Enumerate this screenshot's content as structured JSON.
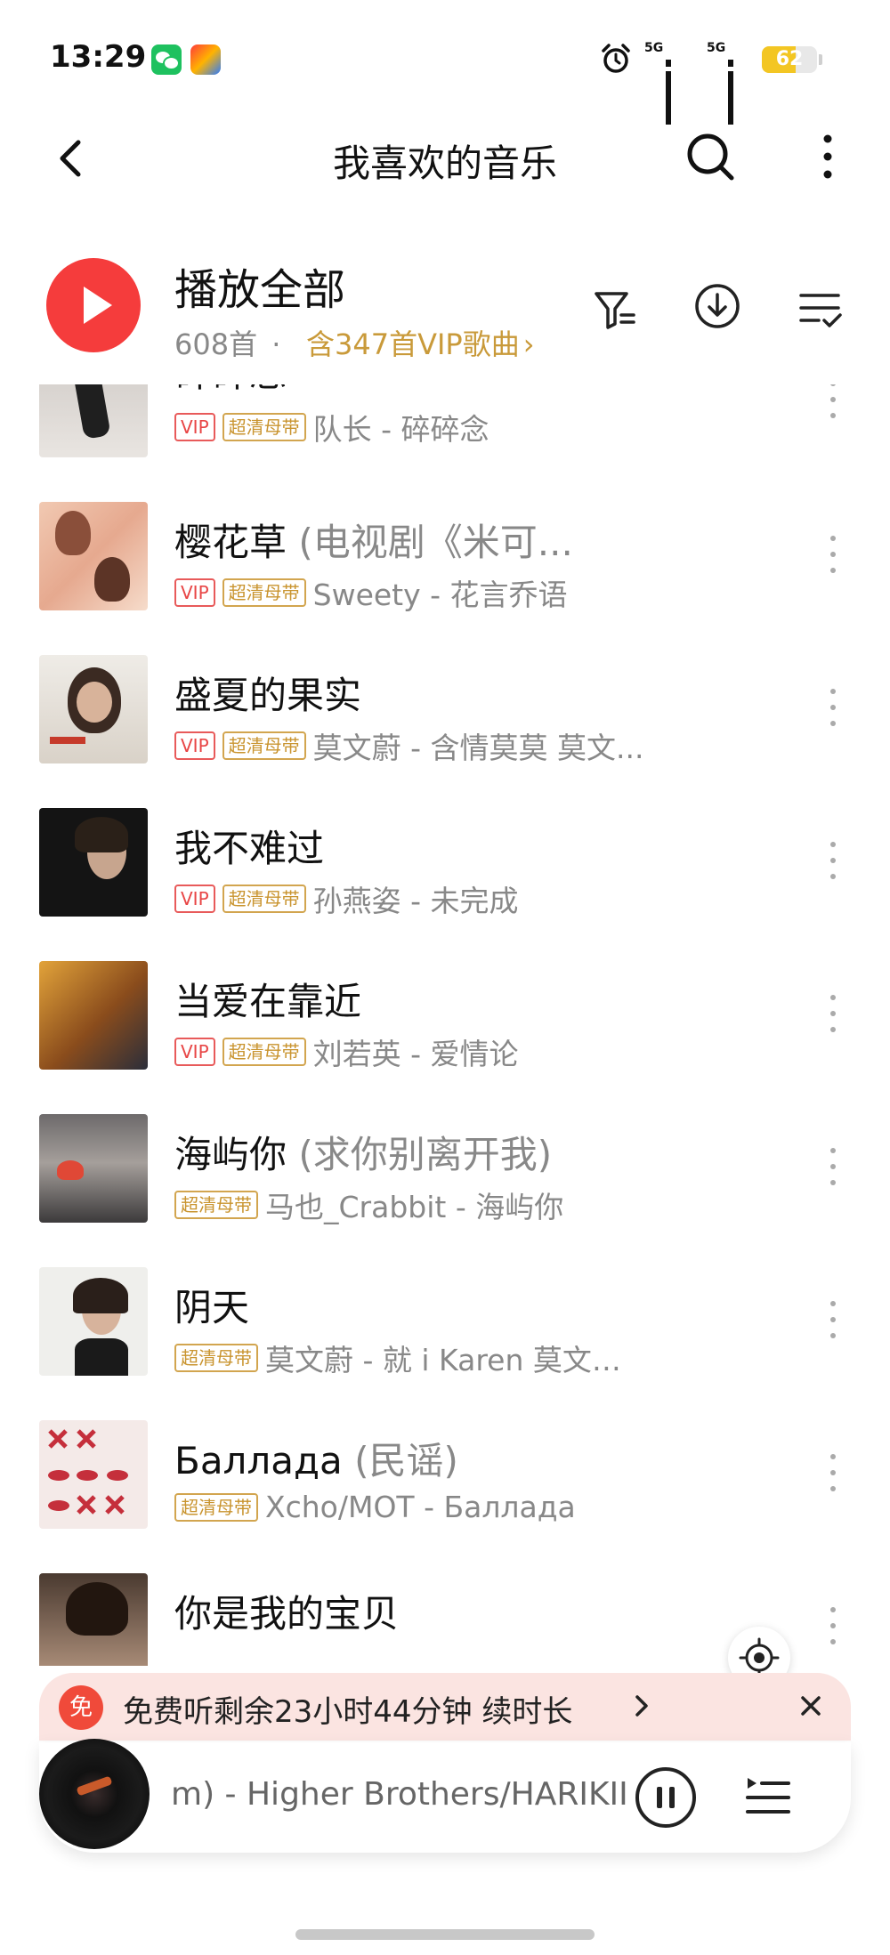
{
  "status_bar": {
    "time": "13:29",
    "icons": [
      "wechat-icon",
      "game-app-icon",
      "alarm-icon",
      "signal-5g-icon",
      "signal-5g-icon"
    ],
    "network_1": "5G",
    "network_2": "5G",
    "battery": "62",
    "battery_color": "#f3c623"
  },
  "nav": {
    "title": "我喜欢的音乐"
  },
  "header": {
    "play_all_label": "播放全部",
    "song_count": "608首",
    "separator": "·",
    "vip_info": "含347首VIP歌曲",
    "vip_chevron": "›"
  },
  "colors": {
    "accent_red": "#f53c3c",
    "vip_gold": "#c99a3a",
    "badge_red": "#e84545"
  },
  "songs": [
    {
      "title": "碎碎念",
      "subtitle": "",
      "vip": "VIP",
      "quality": "超清母带",
      "artist_album": "队长 - 碎碎念"
    },
    {
      "title": "樱花草",
      "subtitle": " (电视剧《米可...",
      "vip": "VIP",
      "quality": "超清母带",
      "artist_album": "Sweety - 花言乔语"
    },
    {
      "title": "盛夏的果实",
      "subtitle": "",
      "vip": "VIP",
      "quality": "超清母带",
      "artist_album": "莫文蔚 - 含情莫莫 莫文..."
    },
    {
      "title": "我不难过",
      "subtitle": "",
      "vip": "VIP",
      "quality": "超清母带",
      "artist_album": "孙燕姿 - 未完成"
    },
    {
      "title": "当爱在靠近",
      "subtitle": "",
      "vip": "VIP",
      "quality": "超清母带",
      "artist_album": "刘若英 - 爱情论"
    },
    {
      "title": "海屿你",
      "subtitle": " (求你别离开我)",
      "vip": "",
      "quality": "超清母带",
      "artist_album": "马也_Crabbit - 海屿你"
    },
    {
      "title": "阴天",
      "subtitle": "",
      "vip": "",
      "quality": "超清母带",
      "artist_album": "莫文蔚 - 就 i Karen 莫文蔚..."
    },
    {
      "title": "Баллада",
      "subtitle": " (民谣)",
      "vip": "",
      "quality": "超清母带",
      "artist_album": "Xcho/MOT - Баллада"
    },
    {
      "title": "你是我的宝贝",
      "subtitle": "",
      "vip": "",
      "quality": "",
      "artist_album": ""
    }
  ],
  "promo": {
    "badge": "免",
    "text": "免费听剩余23小时44分钟 续时长"
  },
  "player": {
    "now_playing": "m) - Higher Brothers/HARIKII"
  }
}
